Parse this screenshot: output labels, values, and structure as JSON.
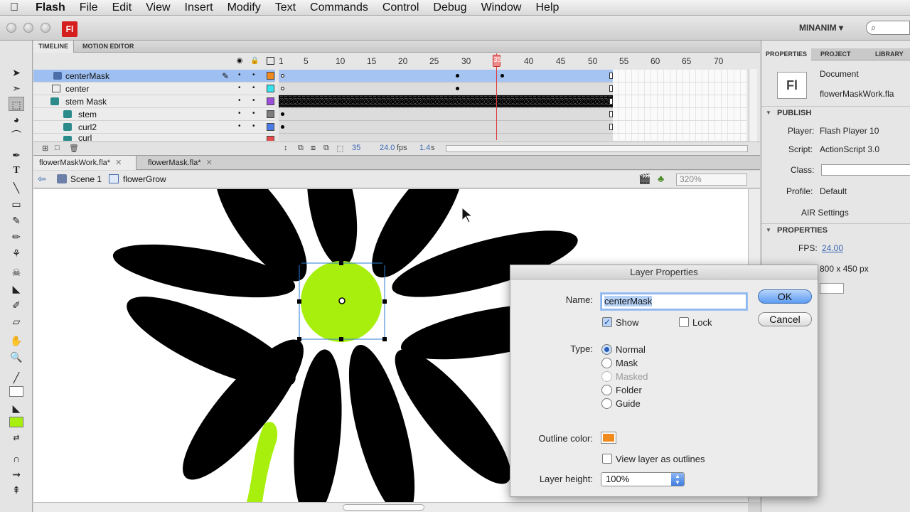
{
  "menubar": {
    "app": "Flash",
    "items": [
      "File",
      "Edit",
      "View",
      "Insert",
      "Modify",
      "Text",
      "Commands",
      "Control",
      "Debug",
      "Window",
      "Help"
    ]
  },
  "appbar": {
    "logo": "Fl",
    "workspace": "MINANIM ▾",
    "search_placeholder": "⌕"
  },
  "timeline": {
    "tabs": [
      "TIMELINE",
      "MOTION EDITOR"
    ],
    "frame_numbers": [
      "1",
      "5",
      "10",
      "15",
      "20",
      "25",
      "30",
      "35",
      "40",
      "45",
      "50",
      "55",
      "60",
      "65",
      "70"
    ],
    "current_frame_marker": "35",
    "layers": [
      {
        "name": "centerMask",
        "color": "#f18a1c",
        "selected": true
      },
      {
        "name": "center",
        "color": "#37e1ee",
        "selected": false
      },
      {
        "name": "stem Mask",
        "color": "#9b4fd8",
        "selected": false
      },
      {
        "name": "stem",
        "color": "#7d7d7d",
        "selected": false
      },
      {
        "name": "curl2",
        "color": "#4a7be6",
        "selected": false
      },
      {
        "name": "curl",
        "color": "#e84b4b",
        "selected": false
      }
    ],
    "footer": {
      "current_frame": "35",
      "fps": "24.0",
      "fps_unit": "fps",
      "time": "1.4",
      "time_unit": "s"
    }
  },
  "doc_tabs": [
    "flowerMaskWork.fla*",
    "flowerMask.fla*"
  ],
  "editbar": {
    "scene": "Scene 1",
    "symbol": "flowerGrow",
    "zoom": "320%"
  },
  "properties": {
    "tabs": [
      "PROPERTIES",
      "PROJECT",
      "LIBRARY"
    ],
    "doc_icon": "Fl",
    "doc_type": "Document",
    "doc_name": "flowerMaskWork.fla",
    "publish_header": "PUBLISH",
    "player_label": "Player:",
    "player_value": "Flash Player 10",
    "script_label": "Script:",
    "script_value": "ActionScript 3.0",
    "class_label": "Class:",
    "profile_label": "Profile:",
    "profile_value": "Default",
    "air_settings": "AIR Settings",
    "properties_header": "PROPERTIES",
    "fps_label": "FPS:",
    "fps_value": "24.00",
    "size_value": "800 x 450 px"
  },
  "dialog": {
    "title": "Layer Properties",
    "name_label": "Name:",
    "name_value": "centerMask",
    "ok_label": "OK",
    "cancel_label": "Cancel",
    "show_label": "Show",
    "show_checked": true,
    "lock_label": "Lock",
    "lock_checked": false,
    "type_label": "Type:",
    "type_options": [
      {
        "label": "Normal",
        "selected": true,
        "disabled": false
      },
      {
        "label": "Mask",
        "selected": false,
        "disabled": false
      },
      {
        "label": "Masked",
        "selected": false,
        "disabled": true
      },
      {
        "label": "Folder",
        "selected": false,
        "disabled": false
      },
      {
        "label": "Guide",
        "selected": false,
        "disabled": false
      }
    ],
    "outline_color_label": "Outline color:",
    "outline_color": "#f18a1c",
    "outline_view_label": "View layer as outlines",
    "layer_height_label": "Layer height:",
    "layer_height_value": "100%"
  },
  "colors": {
    "flower_center": "#a8ef0e",
    "petals": "#000000",
    "stem": "#a8ef0e"
  }
}
